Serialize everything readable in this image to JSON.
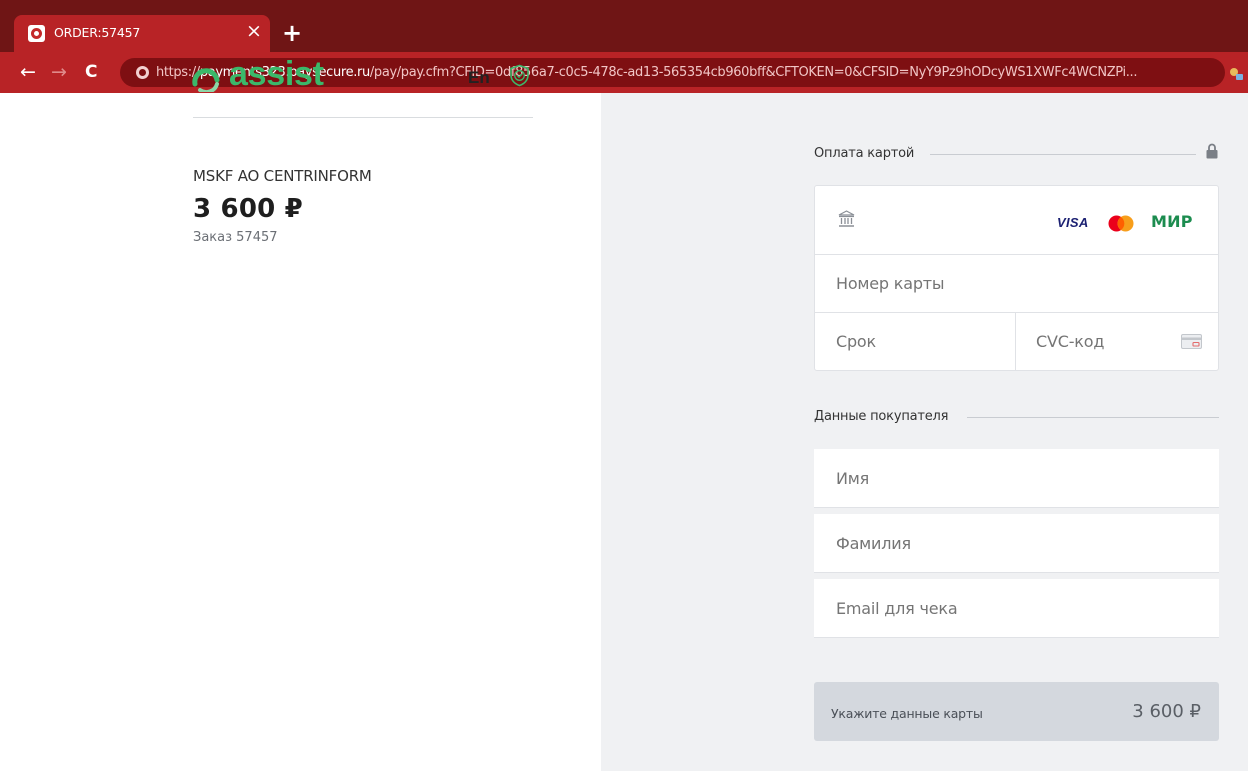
{
  "browser": {
    "tab_title": "ORDER:57457",
    "tab_close": "×",
    "new_tab": "+",
    "back": "←",
    "forward": "→",
    "reload": "C",
    "url_scheme": "https://",
    "url_host": "payments323.paysecure.ru",
    "url_rest": "/pay/pay.cfm?CFID=0df856a7-c0c5-478c-ad13-565354cb960bff&CFTOKEN=0&CFSID=NyY9Pz9hODcyWS1XWFc4WCNZPi..."
  },
  "header": {
    "logo_text": "assist",
    "language": "En"
  },
  "order": {
    "merchant": "MSKF AO CENTRINFORM",
    "amount": "3 600 ₽",
    "order_label": "Заказ 57457"
  },
  "card_section": {
    "title": "Оплата картой",
    "brands": {
      "visa": "VISA",
      "mir": "МИР"
    },
    "card_number_placeholder": "Номер карты",
    "expiry_placeholder": "Срок",
    "cvc_placeholder": "CVC-код"
  },
  "buyer_section": {
    "title": "Данные покупателя",
    "first_name_placeholder": "Имя",
    "last_name_placeholder": "Фамилия",
    "email_placeholder": "Email для чека"
  },
  "pay_button": {
    "label": "Укажите данные карты",
    "amount": "3 600 ₽"
  },
  "colors": {
    "brand_green": "#3bb86a",
    "browser_frame": "#6f1515",
    "browser_toolbar": "#b82326",
    "right_pane_bg": "#f0f1f3",
    "pay_button_bg": "#d4d8de"
  }
}
